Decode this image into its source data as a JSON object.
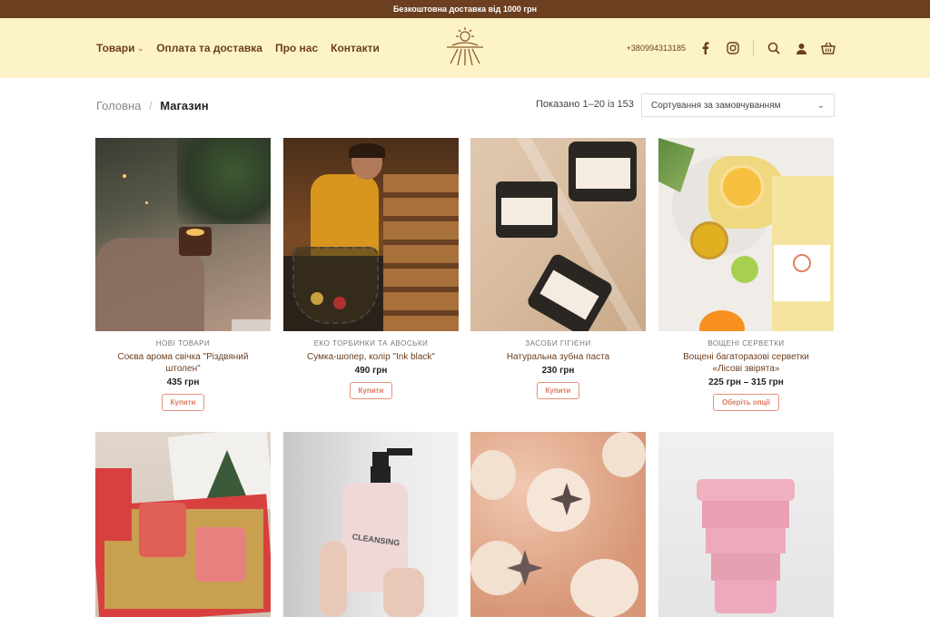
{
  "topbar": {
    "text": "Безкоштовна доставка від 1000 грн"
  },
  "nav": {
    "items": [
      {
        "label": "Товари"
      },
      {
        "label": "Оплата та доставка"
      },
      {
        "label": "Про нас"
      },
      {
        "label": "Контакти"
      }
    ],
    "phone": "+380994313185"
  },
  "breadcrumb": {
    "home": "Головна",
    "separator": "/",
    "current": "Магазин"
  },
  "results": "Показано 1–20 із 153",
  "sort": {
    "selected": "Сортування за замовчуванням"
  },
  "products": [
    {
      "category": "НОВІ ТОВАРИ",
      "name": "Соєва арома свічка \"Різдвяний штолен\"",
      "price": "435 грн",
      "button": "Купити"
    },
    {
      "category": "ЕКО ТОРБИНКИ ТА АВОСЬКИ",
      "name": "Сумка-шопер, колір \"Ink black\"",
      "price": "490 грн",
      "button": "Купити"
    },
    {
      "category": "ЗАСОБИ ГІГІЄНИ",
      "name": "Натуральна зубна паста",
      "price": "230 грн",
      "button": "Купити"
    },
    {
      "category": "ВОЩЕНІ СЕРВЕТКИ",
      "name": "Вощені багаторазові серветки «Лісові звірята»",
      "price": "225 грн – 315 грн",
      "button": "Оберіть опції"
    }
  ],
  "images": {
    "cleansing_label": "CLEANSING"
  },
  "colors": {
    "brand_brown": "#6b3f1f",
    "header_bg": "#fdf3c8",
    "button_accent": "#e8907c"
  }
}
